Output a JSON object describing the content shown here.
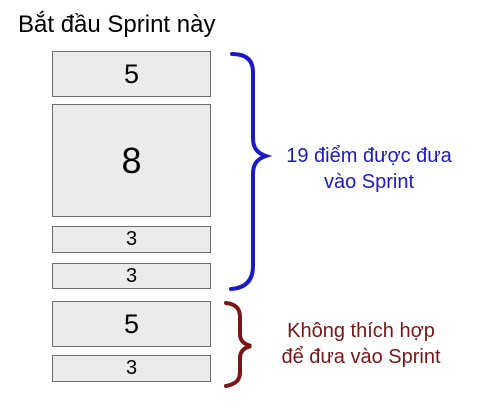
{
  "title": "Bắt đầu Sprint này",
  "boxes": {
    "b1": "5",
    "b2": "8",
    "b3": "3",
    "b4": "3",
    "b5": "5",
    "b6": "3"
  },
  "groups": {
    "included": {
      "line1": "19 điểm được đưa",
      "line2": "vào Sprint",
      "color": "#1a1ac8"
    },
    "excluded": {
      "line1": "Không thích hợp",
      "line2": "để đưa vào Sprint",
      "color": "#7a1515"
    }
  }
}
